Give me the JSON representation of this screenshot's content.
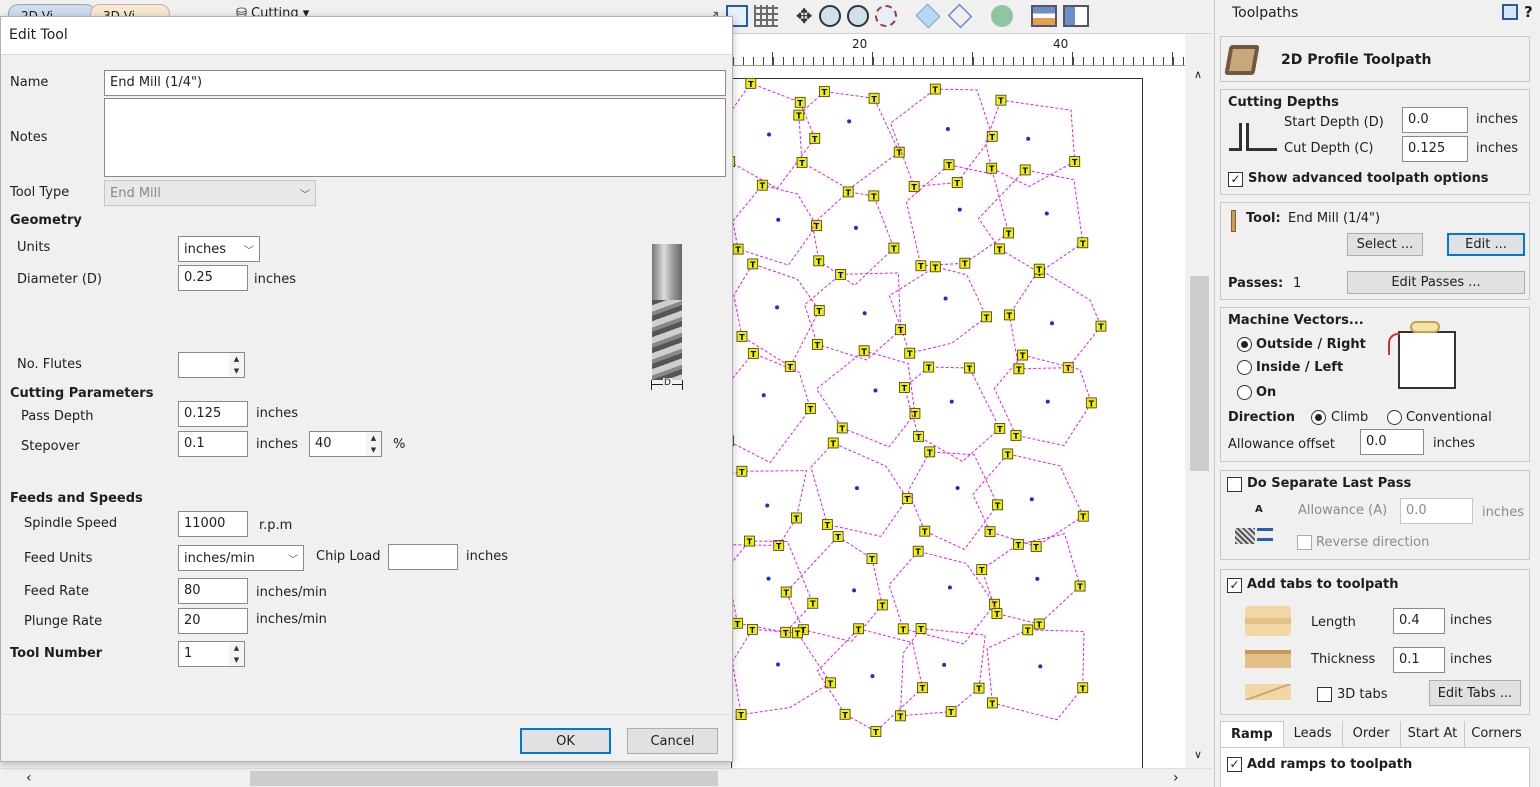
{
  "top": {
    "tab_2d": "2D Vi...",
    "tab_3d": "3D Vi...",
    "cutting_menu": "Cutting ▾"
  },
  "ruler": {
    "tick_20": "20",
    "tick_40": "40"
  },
  "dialog": {
    "title": "Edit Tool",
    "name_label": "Name",
    "name_value": "End Mill (1/4\")",
    "notes_label": "Notes",
    "notes_value": "",
    "tool_type_label": "Tool Type",
    "tool_type_value": "End Mill",
    "geometry_heading": "Geometry",
    "units_label": "Units",
    "units_value": "inches",
    "diameter_label": "Diameter (D)",
    "diameter_value": "0.25",
    "diameter_unit": "inches",
    "flutes_label": "No. Flutes",
    "flutes_value": "",
    "diagram_d": "D",
    "cutting_params_heading": "Cutting Parameters",
    "pass_depth_label": "Pass Depth",
    "pass_depth_value": "0.125",
    "pass_depth_unit": "inches",
    "stepover_label": "Stepover",
    "stepover_value": "0.1",
    "stepover_unit": "inches",
    "stepover_percent": "40",
    "percent_sign": "%",
    "feeds_heading": "Feeds and Speeds",
    "spindle_label": "Spindle Speed",
    "spindle_value": "11000",
    "spindle_unit": "r.p.m",
    "feed_units_label": "Feed Units",
    "feed_units_value": "inches/min",
    "chip_load_label": "Chip Load",
    "chip_load_value": "",
    "chip_load_unit": "inches",
    "feed_rate_label": "Feed Rate",
    "feed_rate_value": "80",
    "feed_rate_unit": "inches/min",
    "plunge_label": "Plunge Rate",
    "plunge_value": "20",
    "plunge_unit": "inches/min",
    "tool_number_label": "Tool Number",
    "tool_number_value": "1",
    "ok": "OK",
    "cancel": "Cancel"
  },
  "panel": {
    "title": "Toolpaths",
    "help": "?",
    "toolpath_name": "2D Profile Toolpath",
    "cutting_depths": "Cutting Depths",
    "start_depth_label": "Start Depth (D)",
    "start_depth_value": "0.0",
    "cut_depth_label": "Cut Depth (C)",
    "cut_depth_value": "0.125",
    "depth_unit": "inches",
    "show_advanced": "Show advanced toolpath options",
    "tool_label": "Tool:",
    "tool_value": "End Mill (1/4\")",
    "select_btn": "Select ...",
    "edit_btn": "Edit ...",
    "passes_label": "Passes:",
    "passes_value": "1",
    "edit_passes_btn": "Edit Passes ...",
    "machine_vectors": "Machine Vectors...",
    "outside_right": "Outside / Right",
    "inside_left": "Inside / Left",
    "on": "On",
    "direction_label": "Direction",
    "climb": "Climb",
    "conventional": "Conventional",
    "allowance_offset_label": "Allowance offset",
    "allowance_offset_value": "0.0",
    "allowance_offset_unit": "inches",
    "separate_last_pass": "Do Separate Last Pass",
    "allowance_a_label": "Allowance (A)",
    "allowance_a_value": "0.0",
    "allowance_a_unit": "inches",
    "reverse_direction": "Reverse direction",
    "diagram_a": "A",
    "add_tabs": "Add tabs to toolpath",
    "length_label": "Length",
    "length_value": "0.4",
    "thickness_label": "Thickness",
    "thickness_value": "0.1",
    "tabs_unit": "inches",
    "tabs_3d": "3D tabs",
    "edit_tabs_btn": "Edit Tabs ...",
    "tabs": [
      "Ramp",
      "Leads",
      "Order",
      "Start At",
      "Corners"
    ],
    "add_ramps": "Add ramps to toolpath"
  },
  "colors": {
    "toolpath": "#e020e0",
    "tab_marker": "#f0f000",
    "accent": "#0078d7"
  }
}
